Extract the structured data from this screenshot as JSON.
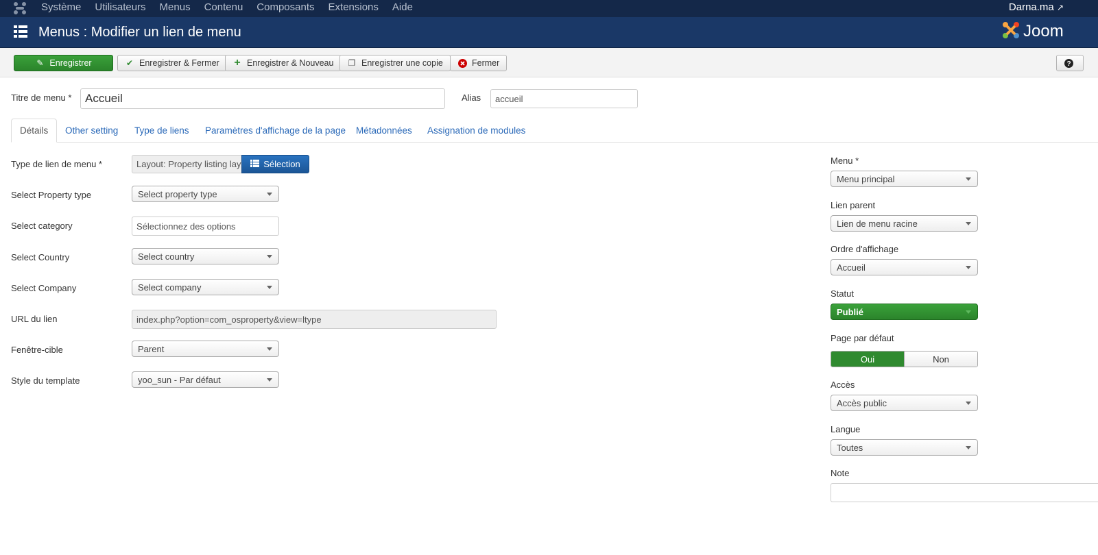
{
  "topnav": {
    "items": [
      "Système",
      "Utilisateurs",
      "Menus",
      "Contenu",
      "Composants",
      "Extensions",
      "Aide"
    ],
    "user": "Darna.ma"
  },
  "header": {
    "title": "Menus : Modifier un lien de menu",
    "brand": "Joom"
  },
  "toolbar": {
    "save": "Enregistrer",
    "save_close": "Enregistrer & Fermer",
    "save_new": "Enregistrer & Nouveau",
    "save_copy": "Enregistrer une copie",
    "close": "Fermer",
    "help": "?"
  },
  "title_field": {
    "label": "Titre de menu *",
    "value": "Accueil"
  },
  "alias_field": {
    "label": "Alias",
    "value": "accueil"
  },
  "tabs": [
    "Détails",
    "Other setting",
    "Type de liens",
    "Paramètres d'affichage de la page",
    "Métadonnées",
    "Assignation de modules"
  ],
  "details": {
    "link_type": {
      "label": "Type de lien de menu *",
      "value": "Layout: Property listing layout",
      "button": "Sélection"
    },
    "property_type": {
      "label": "Select Property type",
      "value": "Select property type"
    },
    "category": {
      "label": "Select category",
      "placeholder": "Sélectionnez des options"
    },
    "country": {
      "label": "Select Country",
      "value": "Select country"
    },
    "company": {
      "label": "Select Company",
      "value": "Select company"
    },
    "url": {
      "label": "URL du lien",
      "value": "index.php?option=com_osproperty&view=ltype"
    },
    "target": {
      "label": "Fenêtre-cible",
      "value": "Parent"
    },
    "template_style": {
      "label": "Style du template",
      "value": "yoo_sun - Par défaut"
    }
  },
  "sidebar": {
    "menu": {
      "label": "Menu *",
      "value": "Menu principal"
    },
    "parent": {
      "label": "Lien parent",
      "value": "Lien de menu racine"
    },
    "order": {
      "label": "Ordre d'affichage",
      "value": "Accueil"
    },
    "status": {
      "label": "Statut",
      "value": "Publié"
    },
    "default_page": {
      "label": "Page par défaut",
      "yes": "Oui",
      "no": "Non"
    },
    "access": {
      "label": "Accès",
      "value": "Accès public"
    },
    "language": {
      "label": "Langue",
      "value": "Toutes"
    },
    "note": {
      "label": "Note",
      "value": ""
    }
  },
  "colors": {
    "topbar": "#142849",
    "header": "#1a3867",
    "save_green": "#2f8a2f",
    "link_blue": "#2a69b8",
    "select_blue": "#1e5fa3"
  },
  "icons": {
    "joomla": "joomla-logo-icon",
    "header": "list-grid-icon",
    "external": "external-link-icon"
  }
}
